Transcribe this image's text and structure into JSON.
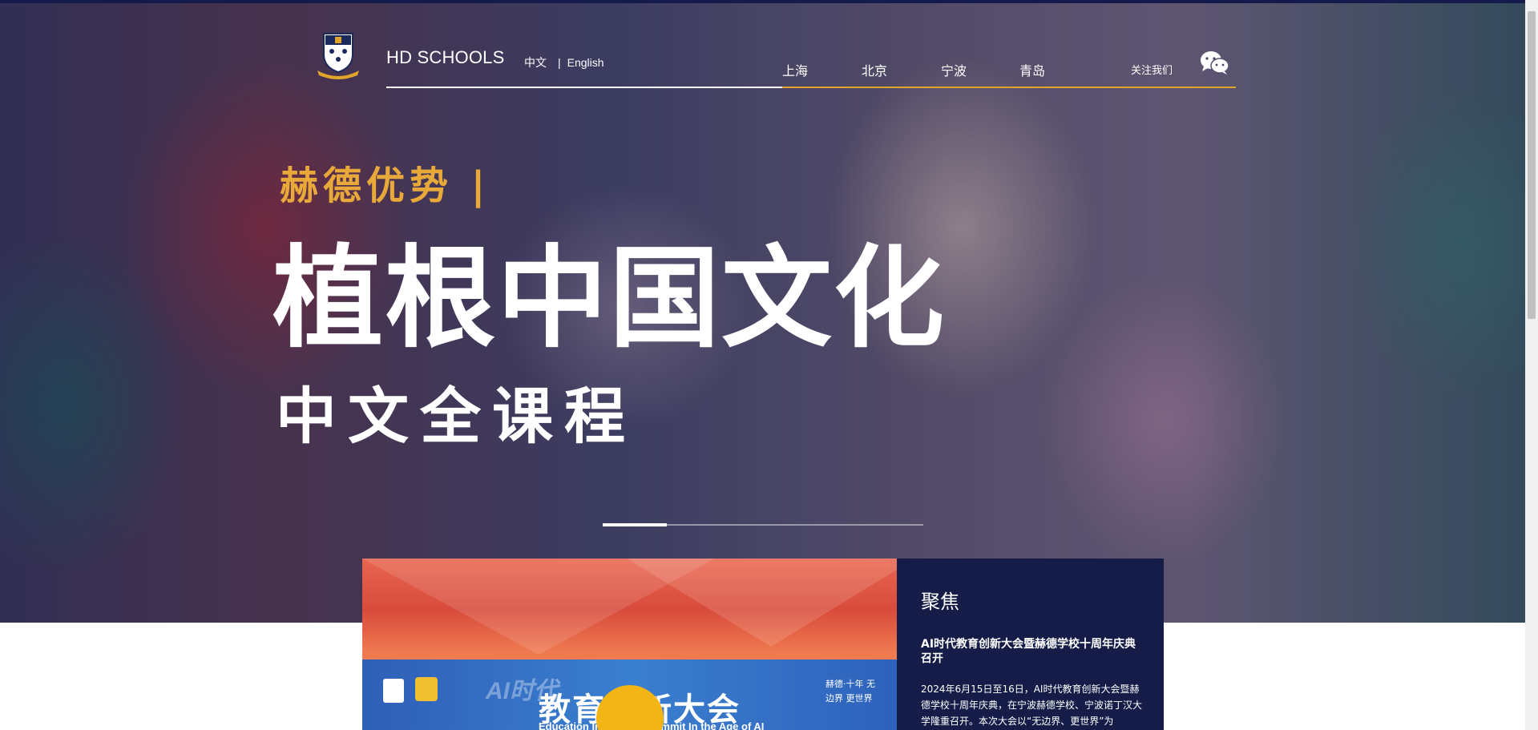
{
  "header": {
    "brand": "HD SCHOOLS",
    "lang_cn": "中文",
    "lang_sep": "|",
    "lang_en": "English",
    "nav": [
      "上海",
      "北京",
      "宁波",
      "青岛"
    ],
    "follow": "关注我们",
    "wechat_icon": "wechat-icon"
  },
  "hero": {
    "gold_line": "赫德优势 |",
    "title": "植根中国文化",
    "subtitle": "中文全课程",
    "slide_active": 1,
    "slide_count": 5
  },
  "video": {
    "banner_ai": "AI时代",
    "banner_cn": "教育创新大会",
    "banner_en": "Education Innovation Summit In the Age of AI",
    "banner_right": "赫德·十年 无边界 更世界",
    "play_icon": "play-icon"
  },
  "focus": {
    "title": "聚焦",
    "headline": "AI时代教育创新大会暨赫德学校十周年庆典召开",
    "body": "2024年6月15日至16日，AI时代教育创新大会暨赫德学校十周年庆典，在宁波赫德学校、宁波诺丁汉大学隆重召开。本次大会以“无边界、更世界”为"
  },
  "colors": {
    "accent_gold": "#e0a52a",
    "headline_gold": "#e8a93a",
    "navy": "#141c47",
    "play_yellow": "#f2b515"
  }
}
